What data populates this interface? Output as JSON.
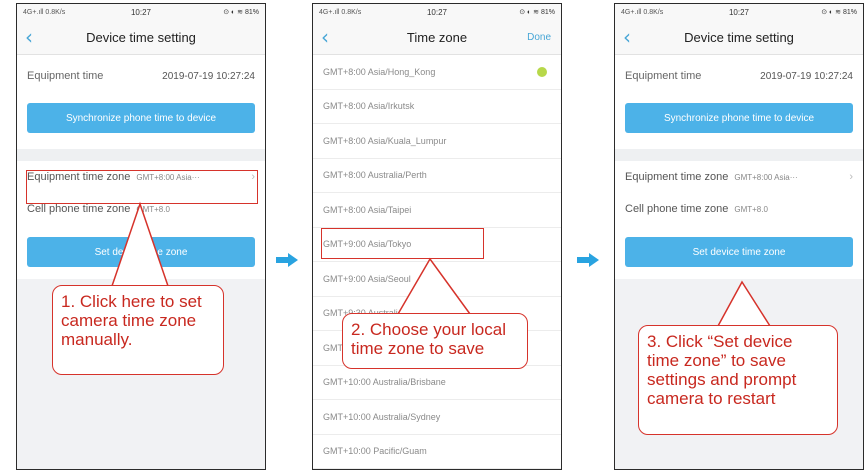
{
  "status_bar": {
    "left": "4G+.ıll 0.8K/s",
    "time": "10:27",
    "right": "⊙ ◐ ≋ 81%"
  },
  "device_time_screen": {
    "title": "Device time setting",
    "equipment_time_label": "Equipment time",
    "equipment_time_value": "2019-07-19 10:27:24",
    "sync_button": "Synchronize phone time to device",
    "equipment_time_zone_label": "Equipment time zone",
    "equipment_time_zone_value": "GMT+8:00 Asia···",
    "cell_phone_time_zone_label": "Cell phone time zone",
    "cell_phone_time_zone_value": "GMT+8.0",
    "set_button": "Set device time zone"
  },
  "time_zone_screen": {
    "title": "Time zone",
    "done": "Done",
    "items": [
      "GMT+8:00 Asia/Hong_Kong",
      "GMT+8:00 Asia/Irkutsk",
      "GMT+8:00 Asia/Kuala_Lumpur",
      "GMT+8:00 Australia/Perth",
      "GMT+8:00 Asia/Taipei",
      "GMT+9:00 Asia/Tokyo",
      "GMT+9:00 Asia/Seoul",
      "GMT+9:30 Australia/Darwin",
      "GMT+9:30 Australia/Adelaide",
      "GMT+10:00 Australia/Brisbane",
      "GMT+10:00 Australia/Sydney",
      "GMT+10:00 Pacific/Guam"
    ]
  },
  "callouts": {
    "step1": "1. Click here to set camera time zone manually.",
    "step2": "2. Choose your local time zone to save",
    "step3": "3. Click “Set device time zone” to save settings and prompt camera to restart"
  },
  "colors": {
    "accent_blue": "#4cb2e8",
    "callout_red": "#d6332b",
    "selected_dot": "#b7d84a"
  }
}
